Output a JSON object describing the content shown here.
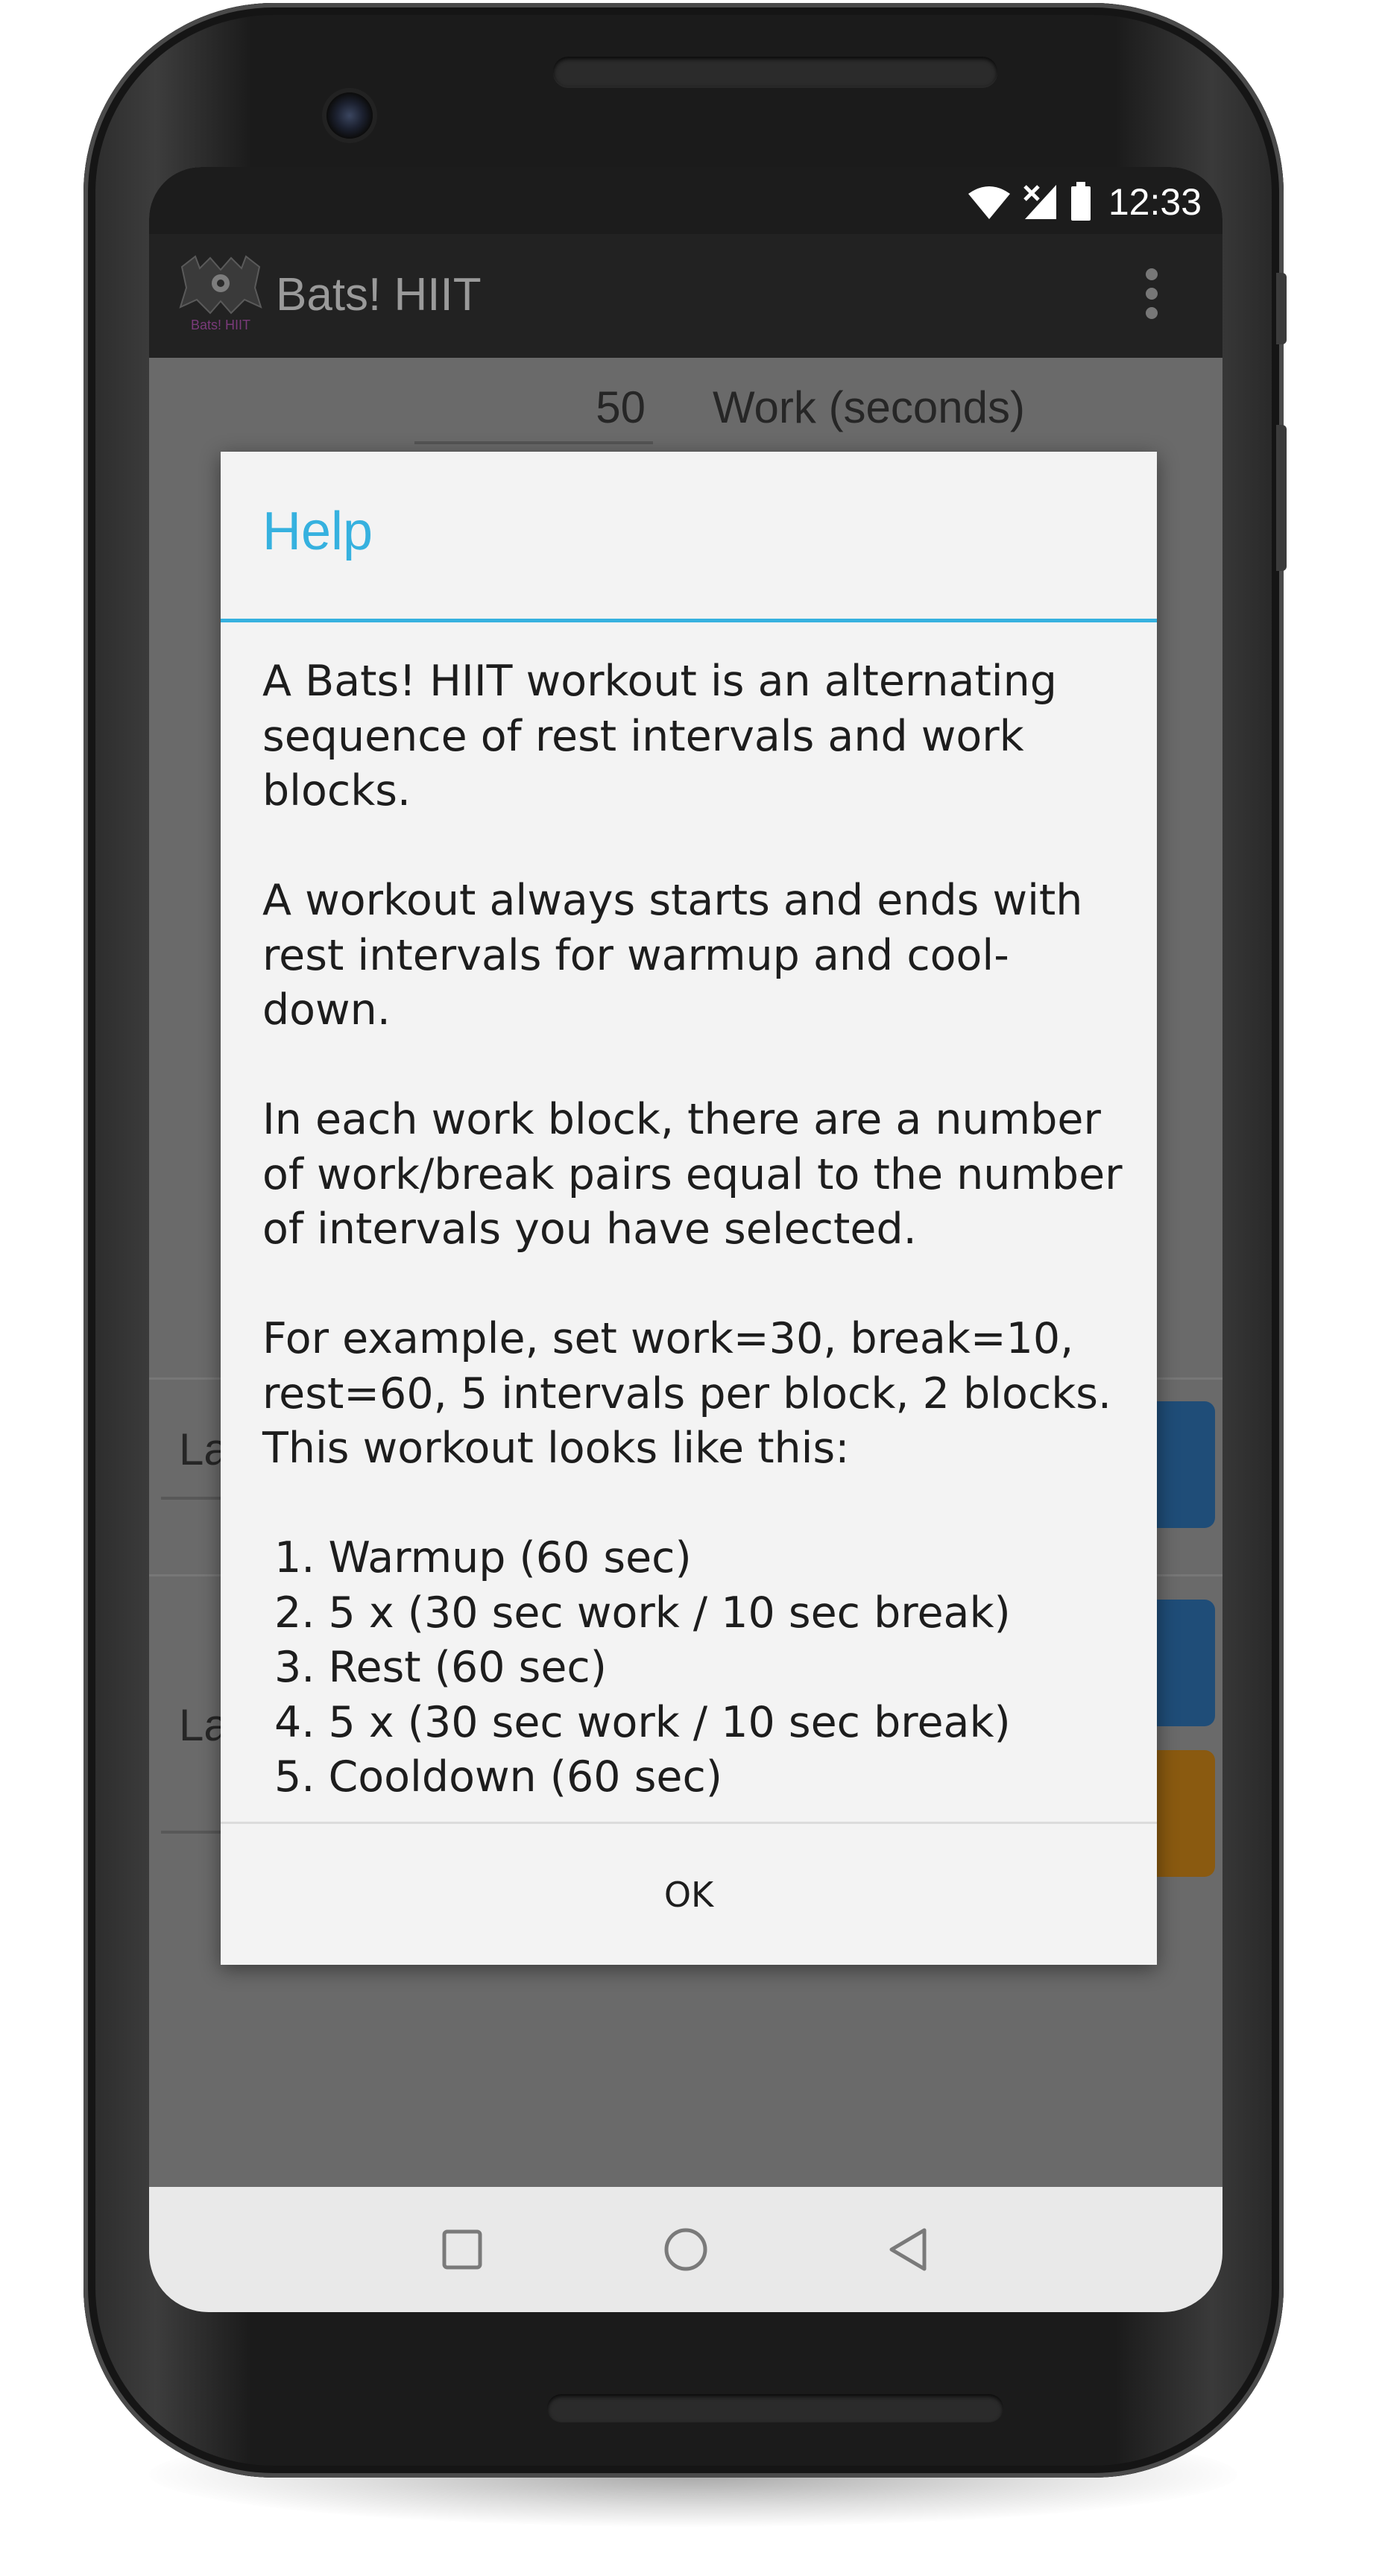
{
  "status_bar": {
    "time": "12:33",
    "icons": [
      "wifi-icon",
      "cell-signal-off-icon",
      "battery-icon"
    ]
  },
  "action_bar": {
    "title": "Bats! HIIT",
    "logo_text": "Bats! HIIT",
    "overflow_icon": "overflow-menu-icon"
  },
  "background": {
    "work_value": "50",
    "work_label": "Work (seconds)",
    "row_label_1": "La",
    "row_label_2": "La",
    "colors": {
      "blue_button": "#1f4d78",
      "orange_button": "#8a5a10"
    }
  },
  "dialog": {
    "title": "Help",
    "paragraphs": [
      "A Bats! HIIT workout is an alternating sequence of rest intervals and work blocks.",
      "A workout always starts and ends with rest intervals for warmup and cool-down.",
      "In each work block, there are a number of work/break pairs equal to the number of intervals you have selected.",
      "For example, set work=30, break=10, rest=60, 5 intervals per block, 2 blocks. This workout looks like this:"
    ],
    "steps": [
      "1. Warmup (60 sec)",
      "2. 5 x (30 sec work / 10 sec break)",
      "3. Rest (60 sec)",
      "4. 5 x (30 sec work / 10 sec break)",
      "5. Cooldown (60 sec)"
    ],
    "ok_label": "OK",
    "accent_color": "#36b1df"
  },
  "nav_bar": {
    "icons": [
      "recents-square-icon",
      "home-circle-icon",
      "back-triangle-icon"
    ]
  }
}
